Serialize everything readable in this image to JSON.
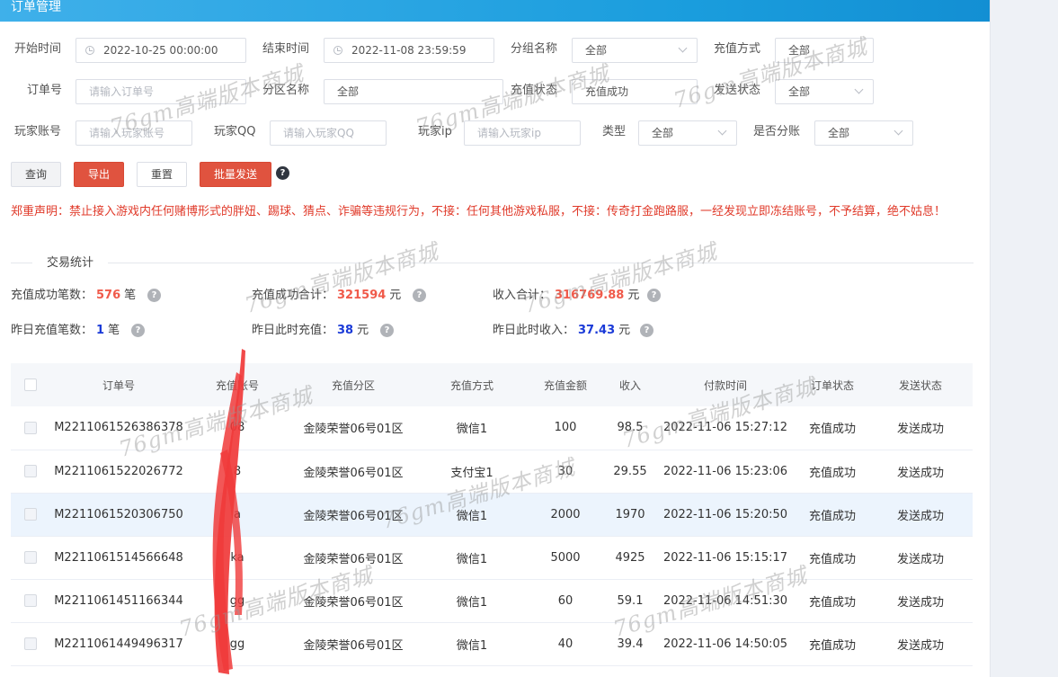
{
  "page": {
    "title": "订单管理"
  },
  "filters": {
    "start_time": {
      "label": "开始时间",
      "value": "2022-10-25 00:00:00"
    },
    "end_time": {
      "label": "结束时间",
      "value": "2022-11-08 23:59:59"
    },
    "group_name": {
      "label": "分组名称",
      "value": "全部"
    },
    "recharge_method": {
      "label": "充值方式",
      "value": "全部"
    },
    "order_no": {
      "label": "订单号",
      "placeholder": "请输入订单号"
    },
    "zone_name": {
      "label": "分区名称",
      "value": "全部"
    },
    "recharge_status": {
      "label": "充值状态",
      "value": "充值成功"
    },
    "send_status": {
      "label": "发送状态",
      "value": "全部"
    },
    "player_account": {
      "label": "玩家账号",
      "placeholder": "请输入玩家账号"
    },
    "player_qq": {
      "label": "玩家QQ",
      "placeholder": "请输入玩家QQ"
    },
    "player_ip": {
      "label": "玩家ip",
      "placeholder": "请输入玩家ip"
    },
    "type": {
      "label": "类型",
      "value": "全部"
    },
    "split": {
      "label": "是否分账",
      "value": "全部"
    }
  },
  "actions": {
    "query": "查询",
    "export": "导出",
    "reset": "重置",
    "batch_send": "批量发送",
    "help_glyph": "?"
  },
  "notice": "郑重声明：禁止接入游戏内任何赌博形式的胖妞、踢球、猜点、诈骗等违规行为，不接：任何其他游戏私服，不接：传奇打金跑路服，一经发现立即冻结账号，不予结算，绝不姑息！",
  "stats_section": {
    "title": "交易统计"
  },
  "stats": {
    "success_count": {
      "label": "充值成功笔数：",
      "value": "576",
      "unit": "笔"
    },
    "success_total": {
      "label": "充值成功合计：",
      "value": "321594",
      "unit": "元"
    },
    "income_total": {
      "label": "收入合计：",
      "value": "316769.88",
      "unit": "元"
    },
    "yesterday_count": {
      "label": "昨日充值笔数：",
      "value": "1",
      "unit": "笔"
    },
    "yesterday_recharge": {
      "label": "昨日此时充值：",
      "value": "38",
      "unit": "元"
    },
    "yesterday_income": {
      "label": "昨日此时收入：",
      "value": "37.43",
      "unit": "元"
    }
  },
  "table": {
    "columns": [
      "订单号",
      "充值账号",
      "充值分区",
      "充值方式",
      "充值金额",
      "收入",
      "付款时间",
      "订单状态",
      "发送状态"
    ],
    "rows": [
      {
        "order_no": "M2211061526386378",
        "account": "08",
        "zone": "金陵荣誉06号01区",
        "method": "微信1",
        "amount": "100",
        "income": "98.5",
        "time": "2022-11-06 15:27:12",
        "status": "充值成功",
        "send": "发送成功"
      },
      {
        "order_no": "M2211061522026772",
        "account": "8",
        "zone": "金陵荣誉06号01区",
        "method": "支付宝1",
        "amount": "30",
        "income": "29.55",
        "time": "2022-11-06 15:23:06",
        "status": "充值成功",
        "send": "发送成功"
      },
      {
        "order_no": "M2211061520306750",
        "account": "a",
        "zone": "金陵荣誉06号01区",
        "method": "微信1",
        "amount": "2000",
        "income": "1970",
        "time": "2022-11-06 15:20:50",
        "status": "充值成功",
        "send": "发送成功"
      },
      {
        "order_no": "M2211061514566648",
        "account": "ka",
        "zone": "金陵荣誉06号01区",
        "method": "微信1",
        "amount": "5000",
        "income": "4925",
        "time": "2022-11-06 15:15:17",
        "status": "充值成功",
        "send": "发送成功"
      },
      {
        "order_no": "M2211061451166344",
        "account": "gg",
        "zone": "金陵荣誉06号01区",
        "method": "微信1",
        "amount": "60",
        "income": "59.1",
        "time": "2022-11-06 14:51:30",
        "status": "充值成功",
        "send": "发送成功"
      },
      {
        "order_no": "M2211061449496317",
        "account": "gg",
        "zone": "金陵荣誉06号01区",
        "method": "微信1",
        "amount": "40",
        "income": "39.4",
        "time": "2022-11-06 14:50:05",
        "status": "充值成功",
        "send": "发送成功"
      }
    ]
  },
  "watermark": "76gm高端版本商城",
  "colors": {
    "title_bar": "#1a9ddd",
    "danger": "#e0533f",
    "stat_red": "#f05a4a",
    "stat_blue": "#1a3ad8",
    "notice_red": "#e03a2a",
    "highlight_row": "#ecf4fd"
  }
}
